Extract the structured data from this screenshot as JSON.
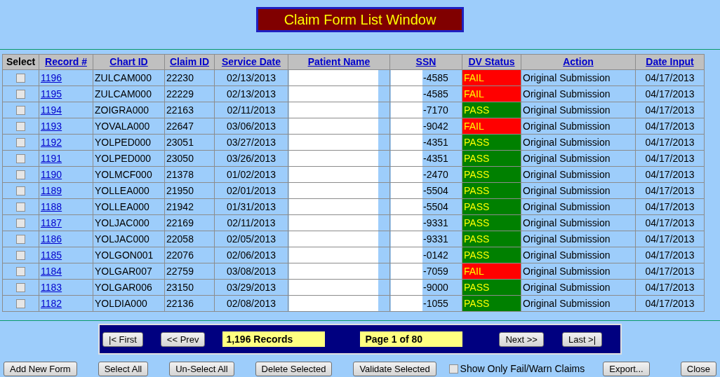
{
  "title": "Claim Form List Window",
  "columns": [
    "Select",
    "Record #",
    "Chart ID",
    "Claim ID",
    "Service Date",
    "Patient Name",
    "SSN",
    "DV Status",
    "Action",
    "Date Input"
  ],
  "rows": [
    {
      "checked": false,
      "record": "1196",
      "chart_id": "ZULCAM000",
      "claim_id": "22230",
      "service_date": "02/13/2013",
      "ssn": "-4585",
      "dv_status": "FAIL",
      "color": "#ff0000",
      "action": "Original Submission",
      "date_input": "04/17/2013"
    },
    {
      "checked": false,
      "record": "1195",
      "chart_id": "ZULCAM000",
      "claim_id": "22229",
      "service_date": "02/13/2013",
      "ssn": "-4585",
      "dv_status": "FAIL",
      "color": "#ff0000",
      "action": "Original Submission",
      "date_input": "04/17/2013"
    },
    {
      "checked": false,
      "record": "1194",
      "chart_id": "ZOIGRA000",
      "claim_id": "22163",
      "service_date": "02/11/2013",
      "ssn": "-7170",
      "dv_status": "PASS",
      "color": "#008000",
      "action": "Original Submission",
      "date_input": "04/17/2013"
    },
    {
      "checked": false,
      "record": "1193",
      "chart_id": "YOVALA000",
      "claim_id": "22647",
      "service_date": "03/06/2013",
      "ssn": "-9042",
      "dv_status": "FAIL",
      "color": "#ff0000",
      "action": "Original Submission",
      "date_input": "04/17/2013"
    },
    {
      "checked": false,
      "record": "1192",
      "chart_id": "YOLPED000",
      "claim_id": "23051",
      "service_date": "03/27/2013",
      "ssn": "-4351",
      "dv_status": "PASS",
      "color": "#008000",
      "action": "Original Submission",
      "date_input": "04/17/2013"
    },
    {
      "checked": false,
      "record": "1191",
      "chart_id": "YOLPED000",
      "claim_id": "23050",
      "service_date": "03/26/2013",
      "ssn": "-4351",
      "dv_status": "PASS",
      "color": "#008000",
      "action": "Original Submission",
      "date_input": "04/17/2013"
    },
    {
      "checked": false,
      "record": "1190",
      "chart_id": "YOLMCF000",
      "claim_id": "21378",
      "service_date": "01/02/2013",
      "ssn": "-2470",
      "dv_status": "PASS",
      "color": "#008000",
      "action": "Original Submission",
      "date_input": "04/17/2013"
    },
    {
      "checked": false,
      "record": "1189",
      "chart_id": "YOLLEA000",
      "claim_id": "21950",
      "service_date": "02/01/2013",
      "ssn": "-5504",
      "dv_status": "PASS",
      "color": "#008000",
      "action": "Original Submission",
      "date_input": "04/17/2013"
    },
    {
      "checked": false,
      "record": "1188",
      "chart_id": "YOLLEA000",
      "claim_id": "21942",
      "service_date": "01/31/2013",
      "ssn": "-5504",
      "dv_status": "PASS",
      "color": "#008000",
      "action": "Original Submission",
      "date_input": "04/17/2013"
    },
    {
      "checked": false,
      "record": "1187",
      "chart_id": "YOLJAC000",
      "claim_id": "22169",
      "service_date": "02/11/2013",
      "ssn": "-9331",
      "dv_status": "PASS",
      "color": "#008000",
      "action": "Original Submission",
      "date_input": "04/17/2013"
    },
    {
      "checked": false,
      "record": "1186",
      "chart_id": "YOLJAC000",
      "claim_id": "22058",
      "service_date": "02/05/2013",
      "ssn": "-9331",
      "dv_status": "PASS",
      "color": "#008000",
      "action": "Original Submission",
      "date_input": "04/17/2013"
    },
    {
      "checked": false,
      "record": "1185",
      "chart_id": "YOLGON001",
      "claim_id": "22076",
      "service_date": "02/06/2013",
      "ssn": "-0142",
      "dv_status": "PASS",
      "color": "#008000",
      "action": "Original Submission",
      "date_input": "04/17/2013"
    },
    {
      "checked": false,
      "record": "1184",
      "chart_id": "YOLGAR007",
      "claim_id": "22759",
      "service_date": "03/08/2013",
      "ssn": "-7059",
      "dv_status": "FAIL",
      "color": "#ff0000",
      "action": "Original Submission",
      "date_input": "04/17/2013"
    },
    {
      "checked": false,
      "record": "1183",
      "chart_id": "YOLGAR006",
      "claim_id": "23150",
      "service_date": "03/29/2013",
      "ssn": "-9000",
      "dv_status": "PASS",
      "color": "#008000",
      "action": "Original Submission",
      "date_input": "04/17/2013"
    },
    {
      "checked": false,
      "record": "1182",
      "chart_id": "YOLDIA000",
      "claim_id": "22136",
      "service_date": "02/08/2013",
      "ssn": "-1055",
      "dv_status": "PASS",
      "color": "#008000",
      "action": "Original Submission",
      "date_input": "04/17/2013"
    }
  ],
  "pager": {
    "first": "|< First",
    "prev": "<< Prev",
    "records": "1,196 Records",
    "page": "Page 1 of 80",
    "next": "Next >>",
    "last": "Last >|"
  },
  "buttons": [
    "Add New Form",
    "Select All",
    "Un-Select All",
    "Delete Selected",
    "Validate Selected"
  ],
  "filter": {
    "label": "Show Only Fail/Warn Claims",
    "checked": false
  },
  "export": "Export...",
  "close": "Close"
}
